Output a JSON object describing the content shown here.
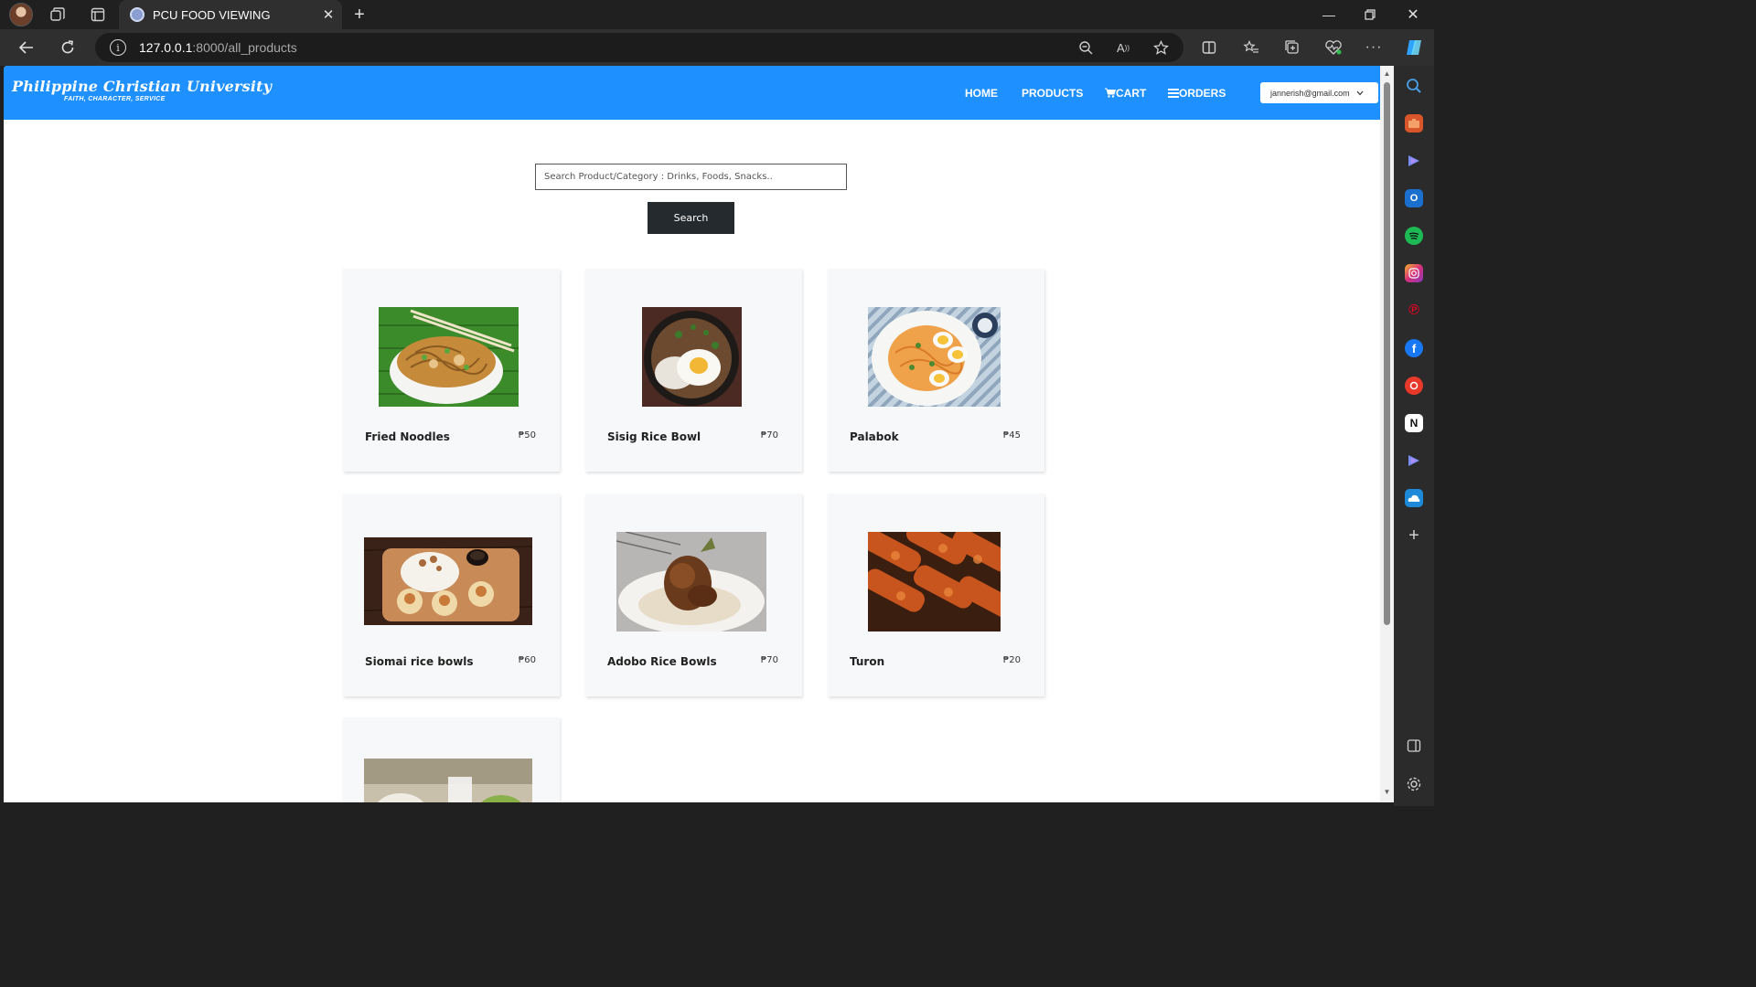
{
  "browser": {
    "tab_title": "PCU FOOD VIEWING",
    "url_host": "127.0.0.1",
    "url_path": ":8000/all_products"
  },
  "site": {
    "brand_name": "Philippine Christian University",
    "brand_tagline": "FAITH, CHARACTER, SERVICE",
    "nav": {
      "home": "HOME",
      "products": "PRODUCTS",
      "cart": "CART",
      "orders": "ORDERS"
    },
    "user_email": "jannerish@gmail.com",
    "header_color": "#1e90ff"
  },
  "search": {
    "placeholder": "Search Product/Category : Drinks, Foods, Snacks..",
    "button_label": "Search"
  },
  "products": [
    {
      "name": "Fried Noodles",
      "price": "₱50",
      "image": "fried-noodles-image"
    },
    {
      "name": "Sisig Rice Bowl",
      "price": "₱70",
      "image": "sisig-rice-bowl-image"
    },
    {
      "name": "Palabok",
      "price": "₱45",
      "image": "palabok-image"
    },
    {
      "name": "Siomai rice bowls",
      "price": "₱60",
      "image": "siomai-rice-bowls-image"
    },
    {
      "name": "Adobo Rice Bowls",
      "price": "₱70",
      "image": "adobo-rice-bowls-image"
    },
    {
      "name": "Turon",
      "price": "₱20",
      "image": "turon-image"
    }
  ]
}
